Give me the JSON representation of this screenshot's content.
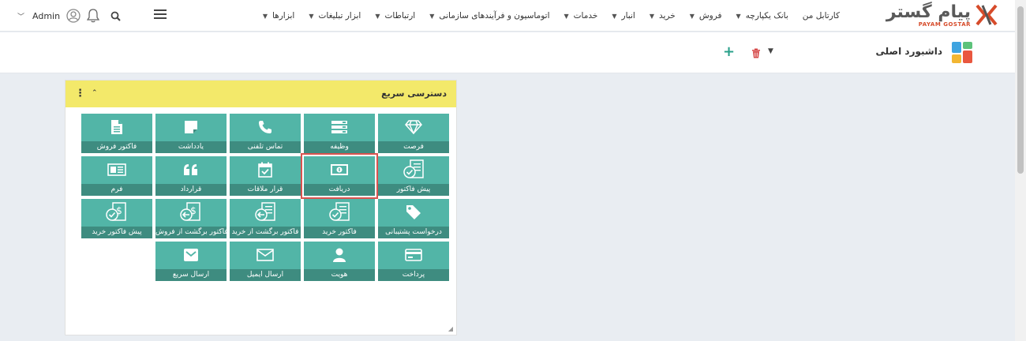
{
  "header": {
    "logo_text": "پیام گستر",
    "logo_sub": "PAYAM GOSTAR",
    "nav": [
      {
        "label": "کارتابل من",
        "has_menu": false
      },
      {
        "label": "بانک یکپارچه",
        "has_menu": true
      },
      {
        "label": "فروش",
        "has_menu": true
      },
      {
        "label": "خرید",
        "has_menu": true
      },
      {
        "label": "انبار",
        "has_menu": true
      },
      {
        "label": "خدمات",
        "has_menu": true
      },
      {
        "label": "اتوماسیون و فرآیندهای سازمانی",
        "has_menu": true
      },
      {
        "label": "ارتباطات",
        "has_menu": true
      },
      {
        "label": "ابزار تبلیغات",
        "has_menu": true
      },
      {
        "label": "ابزارها",
        "has_menu": true
      }
    ],
    "user": "Admin"
  },
  "dashboard": {
    "title": "داشبورد اصلی",
    "add": "+"
  },
  "widget": {
    "title": "دسترسی سریع",
    "menu": "⋮",
    "collapse": "⌃",
    "tiles": [
      {
        "label": "فرصت",
        "icon": "diamond-icon"
      },
      {
        "label": "وظیفه",
        "icon": "list-icon"
      },
      {
        "label": "تماس تلفنی",
        "icon": "phone-icon"
      },
      {
        "label": "یادداشت",
        "icon": "note-icon"
      },
      {
        "label": "فاکتور فروش",
        "icon": "document-icon"
      },
      {
        "label": "پیش فاکتور",
        "icon": "proforma-icon"
      },
      {
        "label": "دریافت",
        "icon": "money-icon",
        "highlighted": true
      },
      {
        "label": "قرار ملاقات",
        "icon": "calendar-check-icon"
      },
      {
        "label": "قرارداد",
        "icon": "quote-icon"
      },
      {
        "label": "فرم",
        "icon": "form-icon"
      },
      {
        "label": "درخواست پشتیبانی",
        "icon": "tag-icon"
      },
      {
        "label": "فاکتور خرید",
        "icon": "purchase-invoice-icon"
      },
      {
        "label": "فاکتور برگشت از خرید",
        "icon": "purchase-return-icon"
      },
      {
        "label": "فاکتور برگشت از فروش",
        "icon": "sales-return-icon"
      },
      {
        "label": "پیش فاکتور خرید",
        "icon": "purchase-proforma-icon"
      },
      {
        "label": "پرداخت",
        "icon": "credit-card-icon"
      },
      {
        "label": "هویت",
        "icon": "user-icon"
      },
      {
        "label": "ارسال ایمیل",
        "icon": "envelope-icon"
      },
      {
        "label": "ارسال سریع",
        "icon": "quick-send-icon"
      }
    ]
  },
  "colors": {
    "tile": "#52b5a7",
    "tile_label": "#3e8c80",
    "widget_header": "#f3e96a",
    "accent": "#2aa08a",
    "highlight": "#d9534f"
  }
}
